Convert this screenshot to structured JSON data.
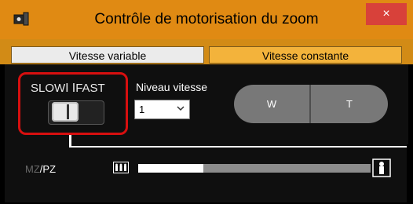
{
  "window": {
    "title": "Contrôle de motorisation du zoom",
    "close_label": "×"
  },
  "tabs": [
    {
      "label": "Vitesse variable",
      "selected": false
    },
    {
      "label": "Vitesse constante",
      "selected": true
    }
  ],
  "speed_switch": {
    "label": "SLOWⅠ ⅠFAST",
    "value": "SLOW"
  },
  "niveau": {
    "label": "Niveau vitesse",
    "value": "1"
  },
  "zoom_buttons": {
    "w_label": "W",
    "t_label": "T"
  },
  "zoom_mode": {
    "mz": "MZ",
    "separator": "/",
    "pz": "PZ"
  },
  "zoom_position": {
    "level": 0.28
  },
  "colors": {
    "title_bar": "#e08a13",
    "highlight_box": "#d70f0f",
    "selected_tab": "#f3b33b",
    "close_button": "#d8413a"
  }
}
